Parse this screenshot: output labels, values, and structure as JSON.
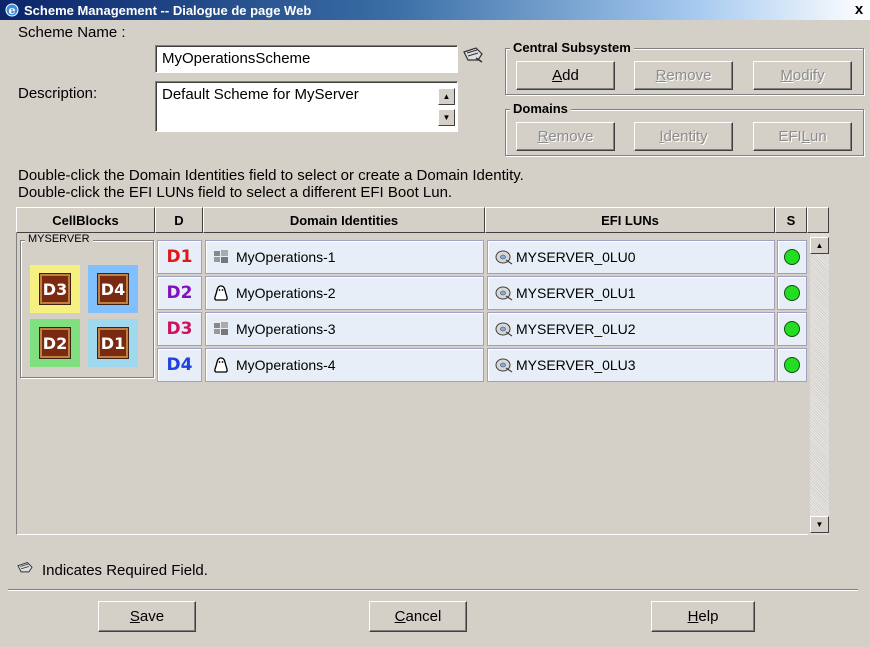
{
  "window": {
    "title": "Scheme Management -- Dialogue de page Web",
    "close": "x"
  },
  "scheme": {
    "name_label": "Scheme Name :",
    "name_value": "MyOperationsScheme"
  },
  "description": {
    "label": "Description:",
    "value": "Default Scheme for MyServer"
  },
  "central_subsystem": {
    "legend": "Central Subsystem",
    "add": {
      "pre": "",
      "key": "A",
      "post": "dd"
    },
    "remove": {
      "pre": "",
      "key": "R",
      "post": "emove"
    },
    "modify": {
      "pre": "",
      "key": "M",
      "post": "odify"
    }
  },
  "domains_group": {
    "legend": "Domains",
    "remove": {
      "pre": "",
      "key": "R",
      "post": "emove"
    },
    "identity": {
      "pre": "",
      "key": "I",
      "post": "dentity"
    },
    "efi_lun": {
      "pre": "EFI ",
      "key": "L",
      "post": "un"
    }
  },
  "hints": {
    "line1": "Double-click the Domain Identities field to select or create a Domain Identity.",
    "line2": "Double-click the EFI LUNs field to select a different EFI Boot Lun."
  },
  "columns": {
    "cellblocks": "CellBlocks",
    "d": "D",
    "identities": "Domain Identities",
    "efi": "EFI LUNs",
    "s": "S"
  },
  "cellblocks": {
    "legend": "MYSERVER",
    "tiles": [
      {
        "label": "D3",
        "bg": "#f5f080"
      },
      {
        "label": "D4",
        "bg": "#80c0ff"
      },
      {
        "label": "D2",
        "bg": "#80e080"
      },
      {
        "label": "D1",
        "bg": "#a0d8f0"
      }
    ]
  },
  "rows": [
    {
      "d": "D1",
      "os_icon": "windows-icon",
      "identity": "MyOperations-1",
      "lun": "MYSERVER_0LU0",
      "status": "green"
    },
    {
      "d": "D2",
      "os_icon": "linux-penguin-icon",
      "identity": "MyOperations-2",
      "lun": "MYSERVER_0LU1",
      "status": "green"
    },
    {
      "d": "D3",
      "os_icon": "windows-icon",
      "identity": "MyOperations-3",
      "lun": "MYSERVER_0LU2",
      "status": "green"
    },
    {
      "d": "D4",
      "os_icon": "linux-penguin-icon",
      "identity": "MyOperations-4",
      "lun": "MYSERVER_0LU3",
      "status": "green"
    }
  ],
  "required_note": "Indicates Required Field.",
  "footer": {
    "save": {
      "pre": "",
      "key": "S",
      "post": "ave"
    },
    "cancel": {
      "pre": "",
      "key": "C",
      "post": "ancel"
    },
    "help": {
      "pre": "",
      "key": "H",
      "post": "elp"
    }
  },
  "colors": {
    "status_ok": "#22dd22",
    "title_start": "#0a246a",
    "title_end": "#a6caf0"
  }
}
